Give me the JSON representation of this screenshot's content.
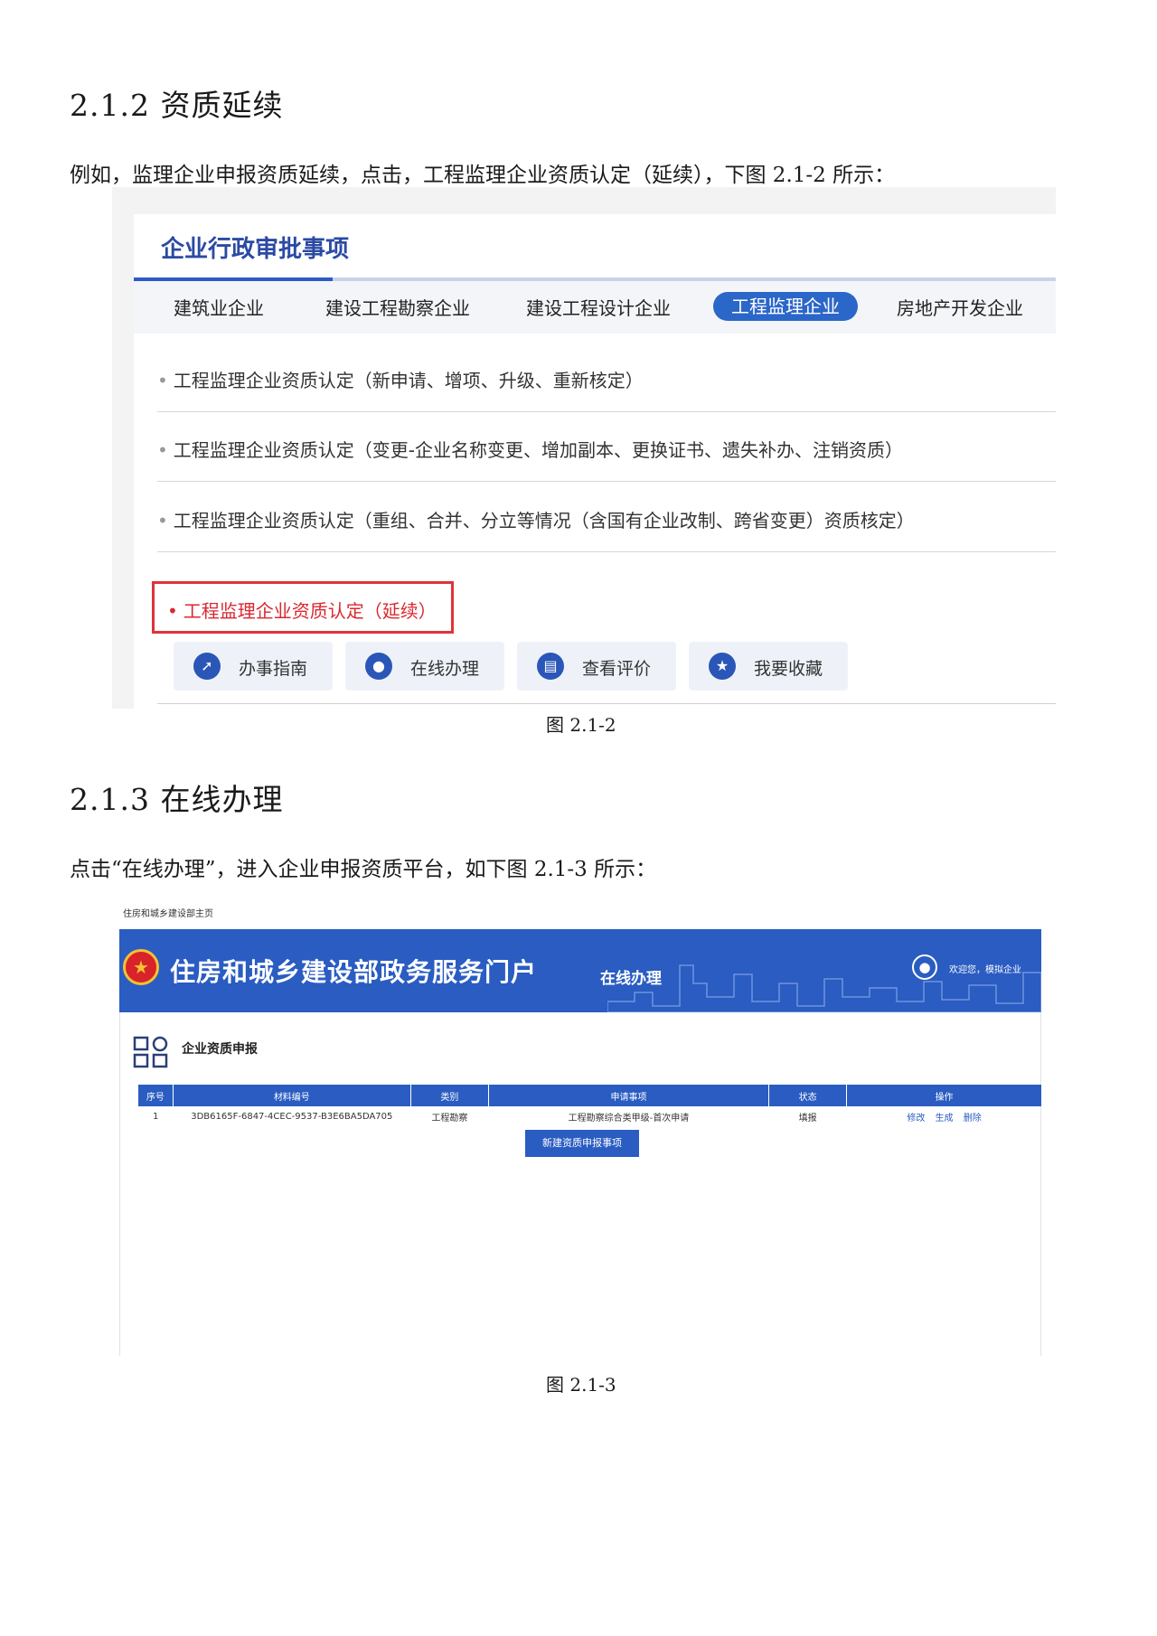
{
  "section1": {
    "heading": "2.1.2 资质延续",
    "paragraph": "例如，监理企业申报资质延续，点击，工程监理企业资质认定（延续），下图 2.1-2 所示：",
    "caption": "图 2.1-2"
  },
  "figure1": {
    "title": "企业行政审批事项",
    "tabs": [
      "建筑业企业",
      "建设工程勘察企业",
      "建设工程设计企业",
      "工程监理企业",
      "房地产开发企业"
    ],
    "active_tab": "工程监理企业",
    "items": [
      "工程监理企业资质认定（新申请、增项、升级、重新核定）",
      "工程监理企业资质认定（变更-企业名称变更、增加副本、更换证书、遗失补办、注销资质）",
      "工程监理企业资质认定（重组、合并、分立等情况（含国有企业改制、跨省变更）资质核定）",
      "工程监理企业资质认定（延续）"
    ],
    "bullet": "•",
    "buttons": [
      "办事指南",
      "在线办理",
      "查看评价",
      "我要收藏"
    ],
    "highlight_color": "#e0333a",
    "accent_color": "#2b66c9"
  },
  "section2": {
    "heading": "2.1.3 在线办理",
    "paragraph": "点击“在线办理”，进入企业申报资质平台，如下图 2.1-3 所示：",
    "caption": "图 2.1-3"
  },
  "figure2": {
    "breadcrumb": "住房和城乡建设部主页",
    "site_title": "住房和城乡建设部政务服务门户",
    "subtitle": "在线办理",
    "welcome": "欢迎您，模拟企业",
    "heading": "企业资质申报",
    "columns": [
      "序号",
      "材料编号",
      "类别",
      "申请事项",
      "状态",
      "操作"
    ],
    "rows": [
      {
        "no": "1",
        "code": "3DB6165F-6847-4CEC-9537-B3E6BA5DA705",
        "category": "工程勘察",
        "item": "工程勘察综合类甲级-首次申请",
        "status": "填报",
        "actions": [
          "修改",
          "生成",
          "删除"
        ]
      }
    ],
    "new_button": "新建资质申报事项",
    "banner_color": "#2a5cc2"
  }
}
